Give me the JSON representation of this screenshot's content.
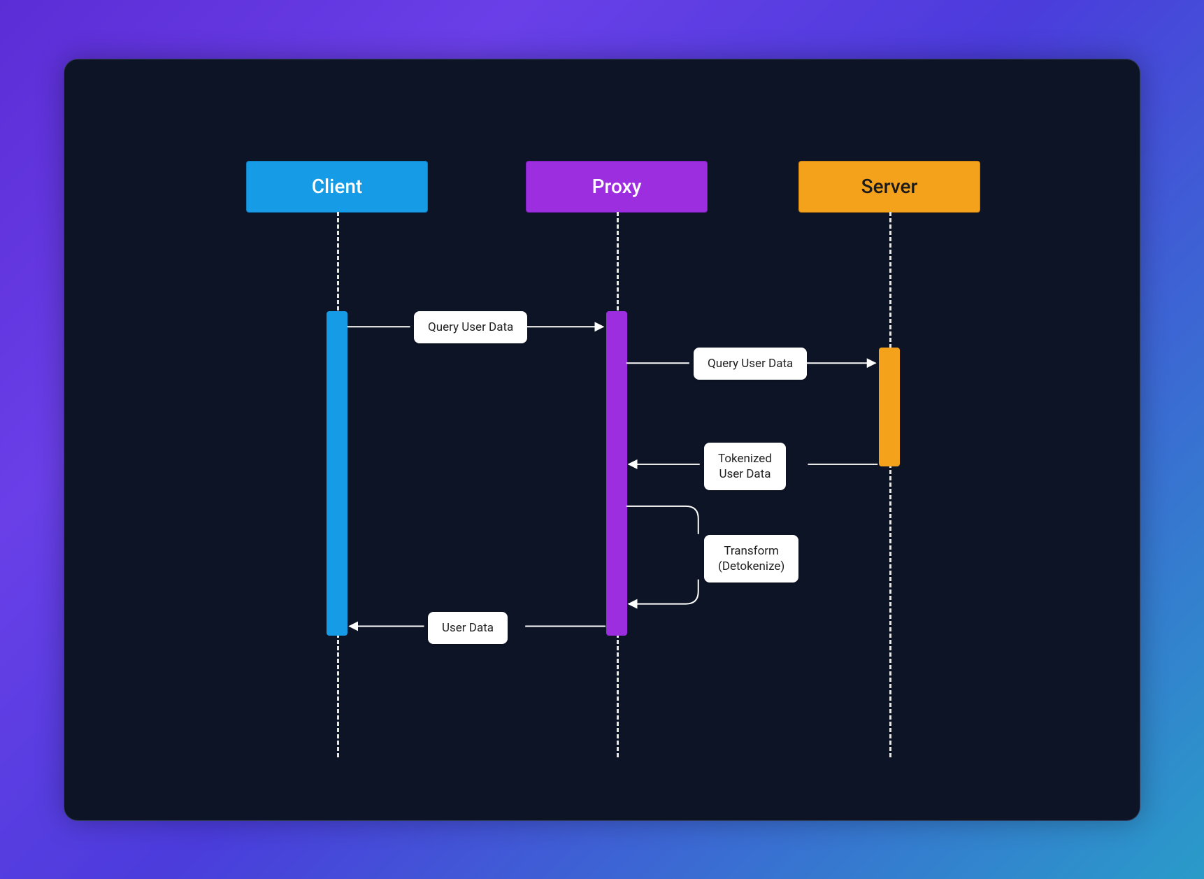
{
  "actors": {
    "client": "Client",
    "proxy": "Proxy",
    "server": "Server"
  },
  "messages": {
    "m1": "Query User Data",
    "m2": "Query User Data",
    "m3_line1": "Tokenized",
    "m3_line2": "User Data",
    "m4_line1": "Transform",
    "m4_line2": "(Detokenize)",
    "m5": "User Data"
  },
  "colors": {
    "client": "#169be6",
    "proxy": "#9c2ee0",
    "server": "#f4a21c",
    "panel_bg": "#0d1425"
  }
}
